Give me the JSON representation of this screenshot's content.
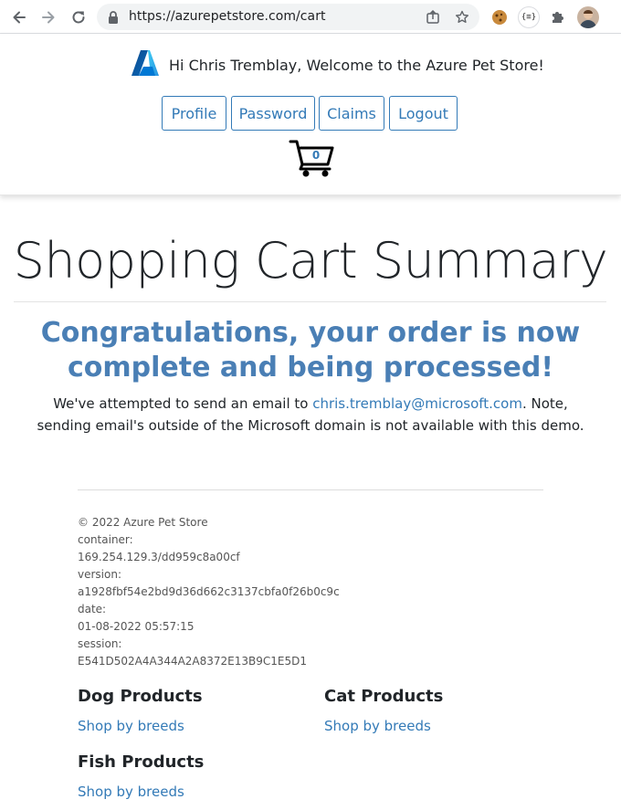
{
  "browser": {
    "url": "https://azurepetstore.com/cart"
  },
  "header": {
    "welcome": "Hi Chris Tremblay, Welcome to the Azure Pet Store!",
    "buttons": {
      "profile": "Profile",
      "password": "Password",
      "claims": "Claims",
      "logout": "Logout"
    },
    "cart_count": "0"
  },
  "main": {
    "title": "Shopping Cart Summary",
    "congrats": "Congratulations, your order is now complete and being processed!",
    "note_prefix": "We've attempted to send an email to ",
    "email": "chris.tremblay@microsoft.com",
    "note_suffix": ". Note, sending email's outside of the Microsoft domain is not available with this demo."
  },
  "footer": {
    "copyright": "© 2022 Azure Pet Store",
    "container_label": "container:",
    "container_value": "169.254.129.3/dd959c8a00cf",
    "version_label": "version:",
    "version_value": "a1928fbf54e2bd9d36d662c3137cbfa0f26b0c9c",
    "date_label": "date:",
    "date_value": "01-08-2022 05:57:15",
    "session_label": "session:",
    "session_value": "E541D502A4A344A2A8372E13B9C1E5D1"
  },
  "categories": [
    {
      "title": "Dog Products",
      "link": "Shop by breeds"
    },
    {
      "title": "Cat Products",
      "link": "Shop by breeds"
    },
    {
      "title": "Fish Products",
      "link": "Shop by breeds"
    }
  ],
  "colors": {
    "brand_blue": "#337ab7",
    "heading_blue": "#4a7fb5"
  }
}
